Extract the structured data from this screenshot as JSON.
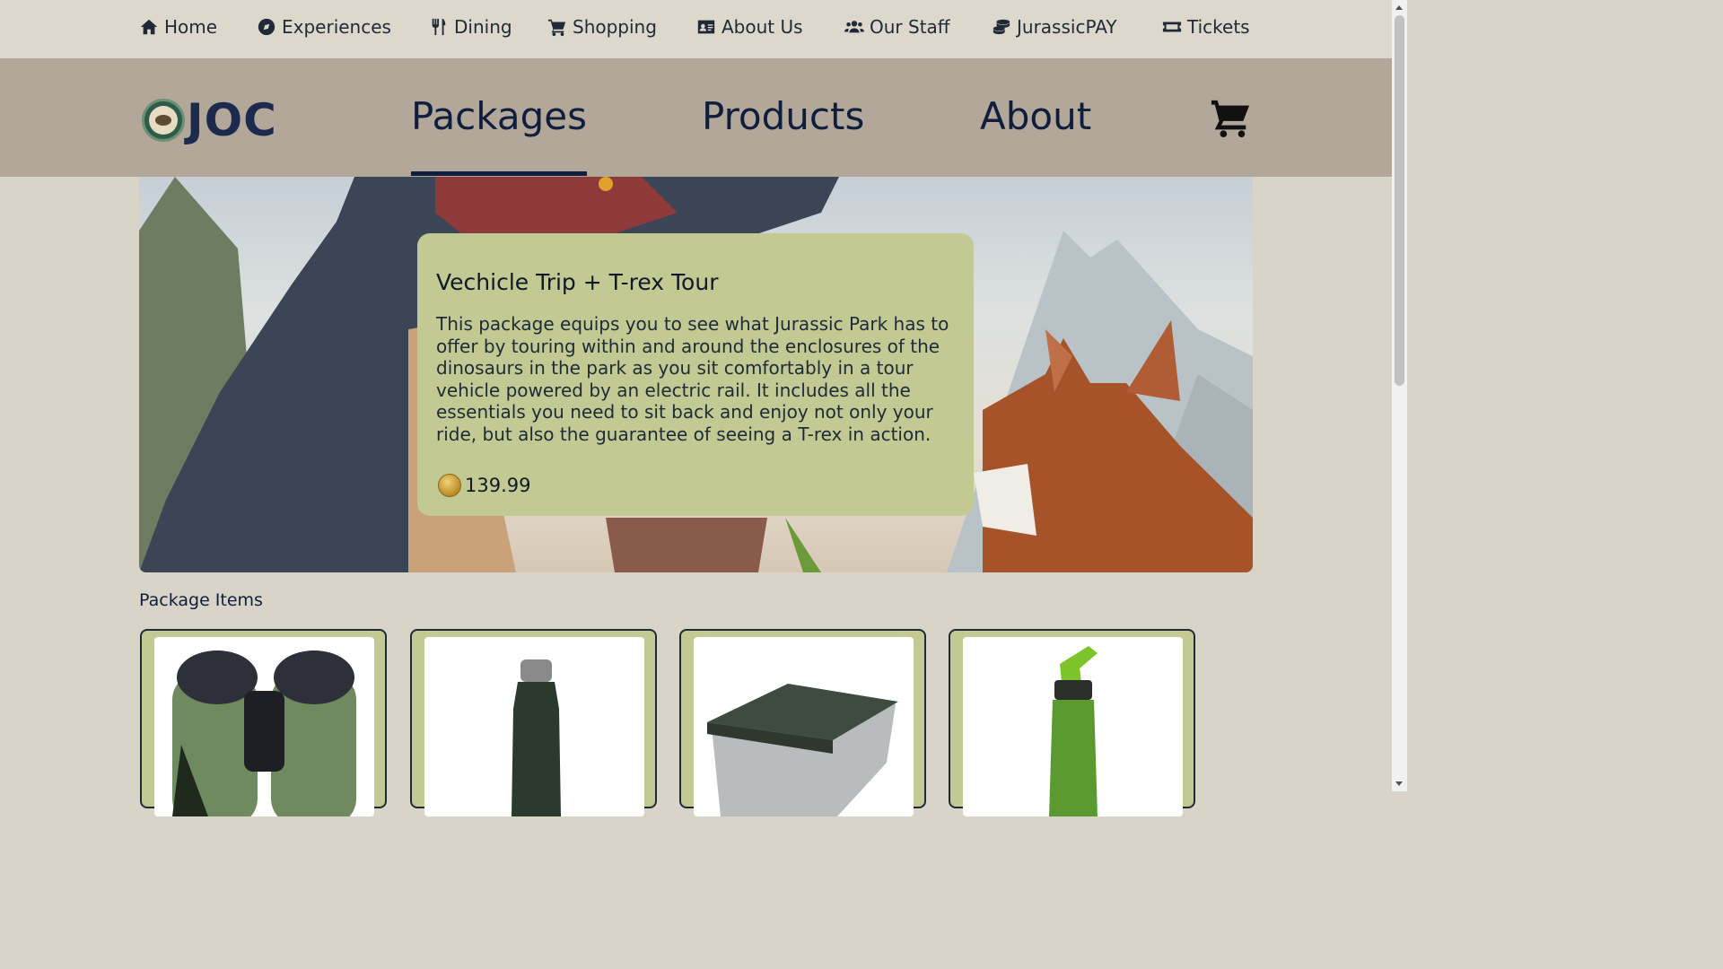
{
  "topnav": {
    "items": [
      {
        "label": "Home",
        "icon": "home-icon"
      },
      {
        "label": "Experiences",
        "icon": "compass-icon"
      },
      {
        "label": "Dining",
        "icon": "utensils-icon"
      },
      {
        "label": "Shopping",
        "icon": "cart-icon"
      },
      {
        "label": "About Us",
        "icon": "id-card-icon"
      },
      {
        "label": "Our Staff",
        "icon": "users-icon"
      },
      {
        "label": "JurassicPAY",
        "icon": "coins-icon"
      },
      {
        "label": "Tickets",
        "icon": "ticket-icon"
      }
    ]
  },
  "header": {
    "logo_text": "JOC",
    "nav": [
      "Packages",
      "Products",
      "About"
    ],
    "active": "Packages",
    "cart_icon": "shopping-cart-icon"
  },
  "package": {
    "title": "Vechicle Trip + T-rex Tour",
    "description": "This package equips you to see what Jurassic Park has to offer by touring within and around the enclosures of the dinosaurs in the park as you sit comfortably in a tour vehicle powered by an electric rail. It includes all the essentials you need to sit back and enjoy not only your ride, but also the guarantee of seeing a T-rex in action.",
    "price": "139.99",
    "currency_icon": "coin-icon"
  },
  "package_items": {
    "title": "Package Items",
    "items": [
      {
        "image": "binoculars"
      },
      {
        "image": "water-bottle"
      },
      {
        "image": "lunch-box"
      },
      {
        "image": "sports-bottle"
      }
    ]
  },
  "colors": {
    "page_bg": "#d8d4c8",
    "header_bg": "#b2a798",
    "card_bg": "#c3c993",
    "nav_text": "#0f1e3d"
  }
}
